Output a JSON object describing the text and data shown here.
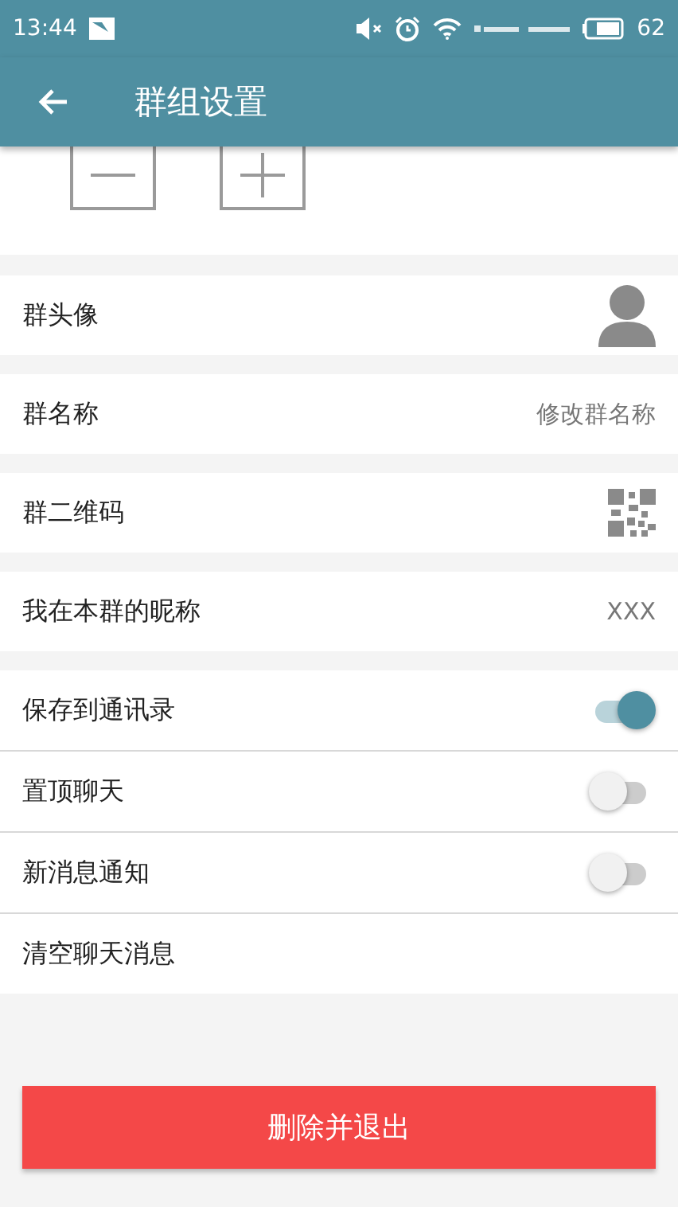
{
  "status_bar": {
    "time": "13:44",
    "battery": "62"
  },
  "app_bar": {
    "title": "群组设置"
  },
  "member_buttons": [
    {
      "kind": "remove"
    },
    {
      "kind": "add"
    }
  ],
  "sections": [
    {
      "rows": [
        {
          "kind": "avatar",
          "label": "群头像"
        }
      ]
    },
    {
      "rows": [
        {
          "kind": "value",
          "label": "群名称",
          "value": "修改群名称"
        }
      ]
    },
    {
      "rows": [
        {
          "kind": "qr",
          "label": "群二维码"
        }
      ]
    },
    {
      "rows": [
        {
          "kind": "value",
          "label": "我在本群的昵称",
          "value": "XXX"
        }
      ]
    },
    {
      "rows": [
        {
          "kind": "toggle",
          "label": "保存到通讯录",
          "on": true
        },
        {
          "kind": "toggle",
          "label": "置顶聊天",
          "on": false
        },
        {
          "kind": "toggle",
          "label": "新消息通知",
          "on": false
        },
        {
          "kind": "plain",
          "label": "清空聊天消息"
        }
      ]
    }
  ],
  "delete_button": {
    "label": "删除并退出"
  }
}
